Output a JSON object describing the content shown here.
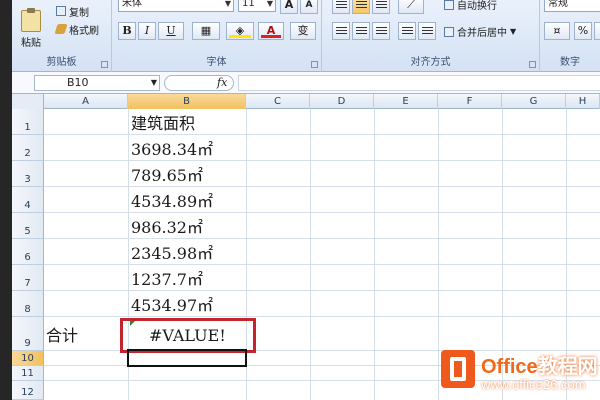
{
  "ribbon": {
    "clipboard": {
      "paste": "粘贴",
      "copy": "复制",
      "format_painter": "格式刷",
      "label": "剪贴板"
    },
    "font": {
      "name": "宋体",
      "size": "11",
      "bold": "B",
      "italic": "I",
      "underline": "U",
      "ext_char": "变",
      "label": "字体"
    },
    "alignment": {
      "wrap_text": "自动换行",
      "merge_center": "合并后居中",
      "label": "对齐方式"
    },
    "number": {
      "format": "常规",
      "percent": "%",
      "comma": ",",
      "label": "数字"
    }
  },
  "formula_bar": {
    "name_box": "B10",
    "fx": "fx",
    "formula": ""
  },
  "columns": [
    "A",
    "B",
    "C",
    "D",
    "E",
    "F",
    "G",
    "H"
  ],
  "rows": [
    "1",
    "2",
    "3",
    "4",
    "5",
    "6",
    "7",
    "8",
    "9",
    "10",
    "11",
    "12"
  ],
  "cells": {
    "B1": "建筑面积",
    "B2": "3698.34㎡",
    "B3": "789.65㎡",
    "B4": "4534.89㎡",
    "B5": "986.32㎡",
    "B6": "2345.98㎡",
    "B7": "1237.7㎡",
    "B8": "4534.97㎡",
    "A9": "合计",
    "B9": "#VALUE!"
  },
  "watermark": {
    "brand_left": "Office",
    "brand_right": "教程网",
    "url": "www.office26.com"
  }
}
